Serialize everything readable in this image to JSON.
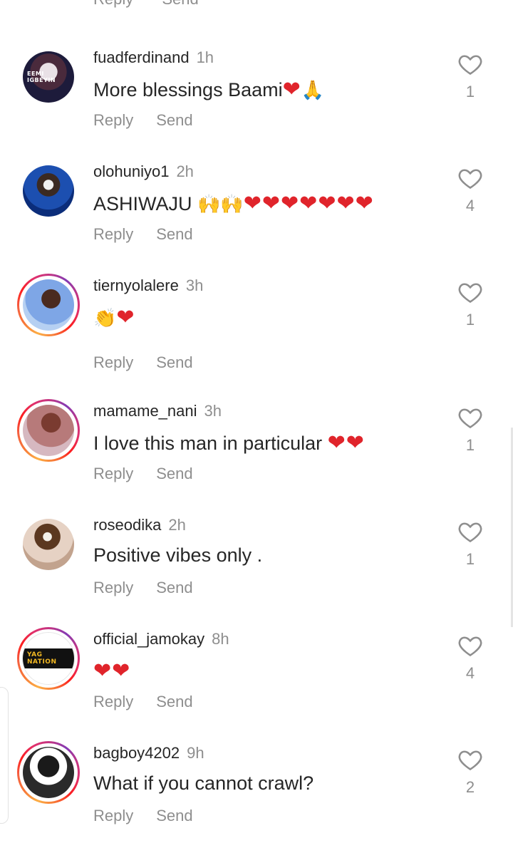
{
  "top_clip": {
    "reply_label": "Reply",
    "send_label": "Send"
  },
  "labels": {
    "reply": "Reply",
    "send": "Send"
  },
  "comments": [
    {
      "username": "fuadferdinand",
      "time": "1h",
      "text": "More blessings Baami",
      "emojis": "❤",
      "extra_emoji": "🙏",
      "likes": "1",
      "avatar_text": "EEMI IGBEYIN"
    },
    {
      "username": "olohuniyo1",
      "time": "2h",
      "text": "ASHIWAJU ",
      "emojis": "🙌🙌",
      "extra_emoji": "❤❤❤❤❤❤❤",
      "likes": "4"
    },
    {
      "username": "tiernyolalere",
      "time": "3h",
      "text": "",
      "emojis": "👏",
      "extra_emoji": "❤",
      "likes": "1"
    },
    {
      "username": "mamame_nani",
      "time": "3h",
      "text": "I love this man in particular ",
      "emojis": "",
      "extra_emoji": "❤❤",
      "likes": "1"
    },
    {
      "username": "roseodika",
      "time": "2h",
      "text": "Positive vibes only .",
      "emojis": "",
      "extra_emoji": "",
      "likes": "1"
    },
    {
      "username": "official_jamokay",
      "time": "8h",
      "text": "",
      "emojis": "",
      "extra_emoji": "❤❤",
      "likes": "4",
      "avatar_text": "YAG NATION"
    },
    {
      "username": "bagboy4202",
      "time": "9h",
      "text": "What if you cannot crawl?",
      "emojis": "",
      "extra_emoji": "",
      "likes": "2"
    }
  ],
  "colors": {
    "heart": "#e0242b",
    "secondary_text": "#8e8e8e",
    "primary_text": "#262626"
  },
  "icons": {
    "like": "heart-outline-icon"
  }
}
